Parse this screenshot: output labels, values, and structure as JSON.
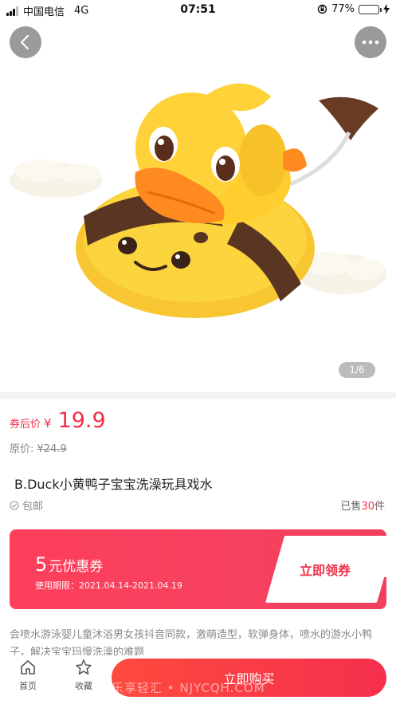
{
  "status_bar": {
    "carrier": "中国电信",
    "network": "4G",
    "time": "07:51",
    "battery_percent": "77%",
    "battery_level": 0.77
  },
  "gallery": {
    "page_indicator": "1/6",
    "image": "duck-bath-toy"
  },
  "price": {
    "label": "券后价",
    "currency": "¥",
    "value": "19.9",
    "original_label": "原价:",
    "original_value": "¥24.9"
  },
  "product": {
    "title": "B.Duck小黄鸭子宝宝洗澡玩具戏水",
    "shipping": "包邮",
    "sold_prefix": "已售",
    "sold_count": "30",
    "sold_suffix": "件"
  },
  "coupon": {
    "amount": "5",
    "amount_suffix": "元优惠券",
    "valid_label": "使用期限：2021.04.14-2021.04.19",
    "button": "立即领券"
  },
  "description": "会喷水游泳婴儿童沐浴男女孩抖音同款，激萌造型，软弹身体，喷水的游水小鸭子，解决宝宝玛慢洗澡的难题",
  "bottom_nav": {
    "home": "首页",
    "favorite": "收藏",
    "buy": "立即购买",
    "watermark": "乐享轻汇 • NJYCQH.COM"
  },
  "colors": {
    "accent": "#f0304a",
    "coupon_bg": "#fd3f5b"
  }
}
